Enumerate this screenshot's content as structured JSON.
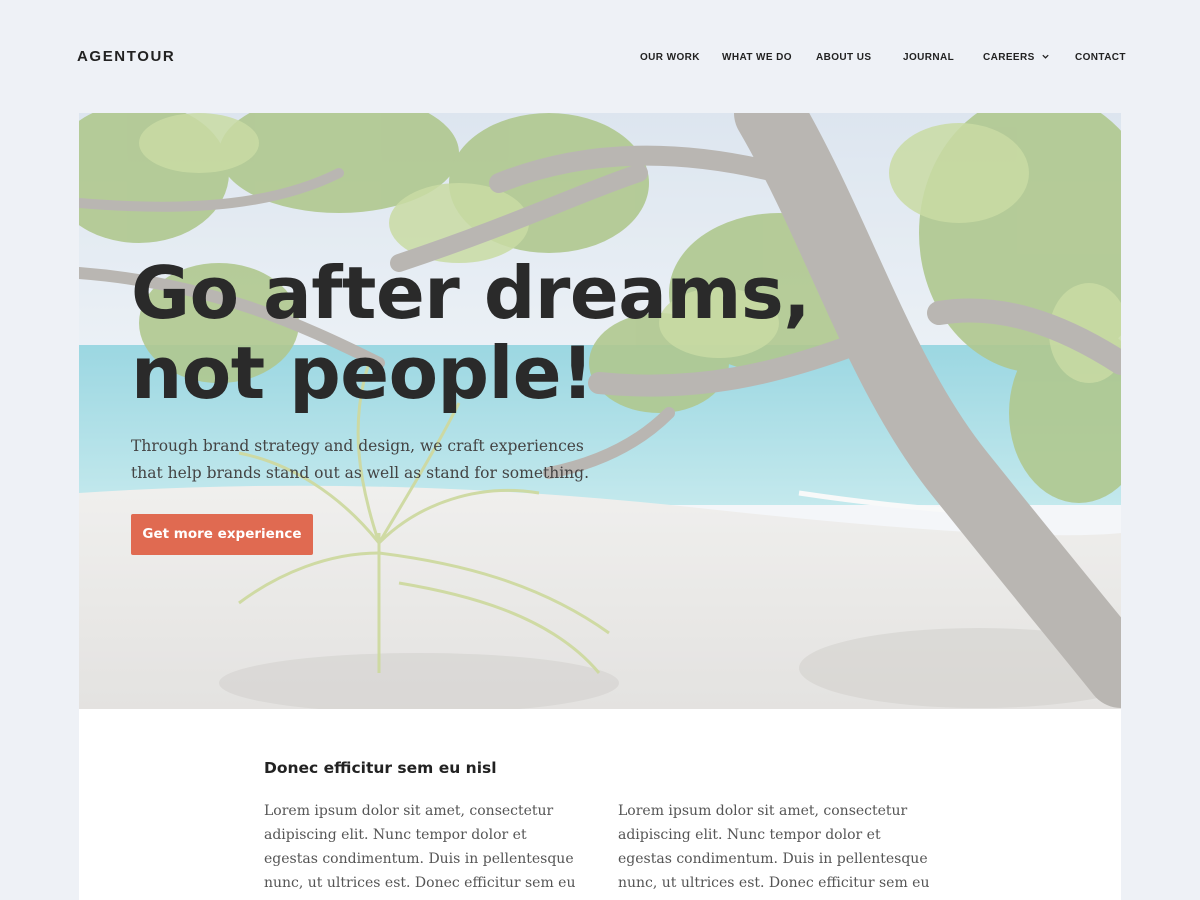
{
  "brand": {
    "logo_text": "AGENTOUR"
  },
  "nav": {
    "items": [
      {
        "label": "OUR WORK"
      },
      {
        "label": "WHAT WE DO"
      },
      {
        "label": "ABOUT US"
      },
      {
        "label": "JOURNAL"
      },
      {
        "label": "CAREERS",
        "icon": "chevron-down-icon"
      },
      {
        "label": "CONTACT"
      }
    ]
  },
  "hero": {
    "title_line1": "Go after dreams,",
    "title_line2": "not people!",
    "subtitle": "Through brand strategy and design, we craft experiences that help brands stand out as well as stand for something.",
    "cta_label": "Get more experience",
    "image_subject": "beach-with-tree-and-palm-photo"
  },
  "content": {
    "heading": "Donec efficitur sem eu nisl",
    "columns": [
      "Lorem ipsum dolor sit amet, consectetur adipiscing elit. Nunc tempor dolor et egestas condimentum. Duis in pellentesque nunc, ut ultrices est. Donec efficitur sem eu nisl venenatis fringilla. Integer eu",
      "Lorem ipsum dolor sit amet, consectetur adipiscing elit. Nunc tempor dolor et egestas condimentum. Duis in pellentesque nunc, ut ultrices est. Donec efficitur sem eu nisl venenatis fringilla. Integer eu"
    ]
  },
  "colors": {
    "page_background": "#eef1f6",
    "accent_button": "#e06a51",
    "text_dark": "#2a2a2a"
  }
}
